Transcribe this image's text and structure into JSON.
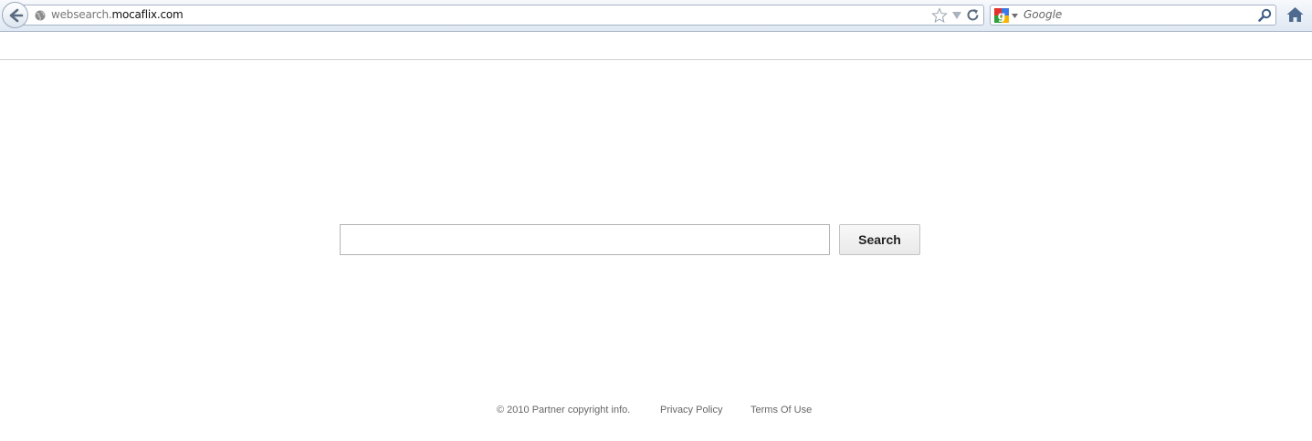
{
  "browser": {
    "url_prefix": "websearch.",
    "url_host": "mocaflix.com",
    "search_engine_placeholder": "Google"
  },
  "main": {
    "search_input_value": "",
    "search_button_label": "Search"
  },
  "footer": {
    "copyright": "© 2010 Partner copyright info.",
    "privacy": "Privacy Policy",
    "terms": "Terms Of Use"
  },
  "icons": {
    "back": "back-arrow-icon",
    "site": "globe-icon",
    "bookmark": "star-icon",
    "history": "dropdown-arrow-icon",
    "reload": "reload-icon",
    "engine": "google-icon",
    "search": "magnifier-icon",
    "home": "home-icon"
  },
  "colors": {
    "toolbar_top": "#f7f9fc",
    "toolbar_bottom": "#dfe8f3",
    "footer_text": "#666666"
  }
}
